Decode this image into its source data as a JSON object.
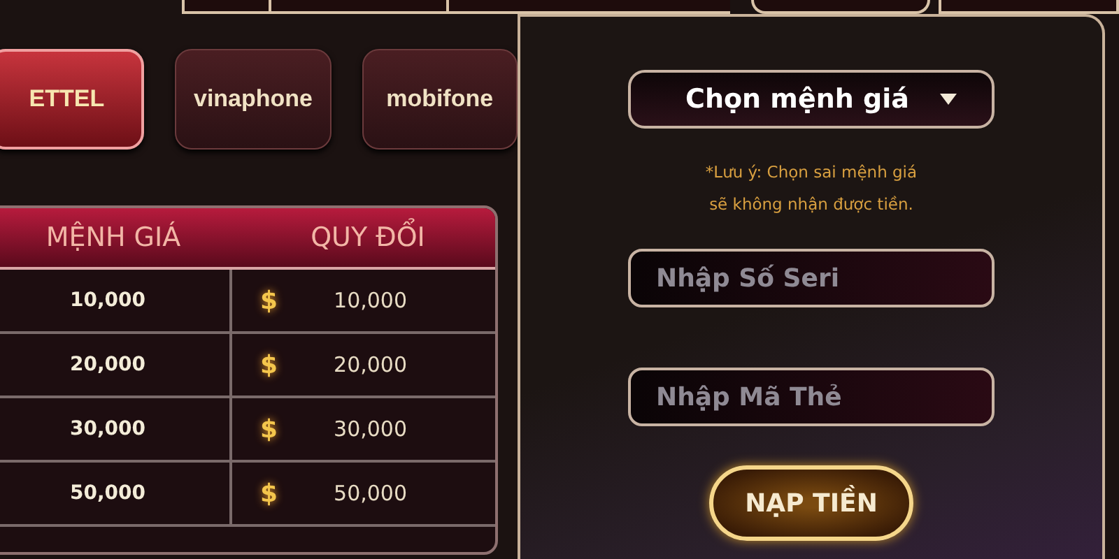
{
  "carriers": [
    {
      "name": "ETTEL",
      "selected": true
    },
    {
      "name": "vinaphone",
      "selected": false
    },
    {
      "name": "mobifone",
      "selected": false
    }
  ],
  "table": {
    "columns": [
      "MỆNH GIÁ",
      "QUY ĐỔI"
    ],
    "rows": [
      {
        "value": "10,000",
        "currency": "$",
        "converted": "10,000"
      },
      {
        "value": "20,000",
        "currency": "$",
        "converted": "20,000"
      },
      {
        "value": "30,000",
        "currency": "$",
        "converted": "30,000"
      },
      {
        "value": "50,000",
        "currency": "$",
        "converted": "50,000"
      }
    ]
  },
  "form": {
    "denomination_select": "Chọn mệnh giá",
    "note_lines": [
      "*Lưu ý: Chọn sai mệnh giá",
      "sẽ không nhận được tiền."
    ],
    "serial_field": {
      "placeholder": "Nhập Số Seri"
    },
    "code_field": {
      "placeholder": "Nhập Mã Thẻ"
    },
    "submit": "NẠP TIỀN"
  }
}
